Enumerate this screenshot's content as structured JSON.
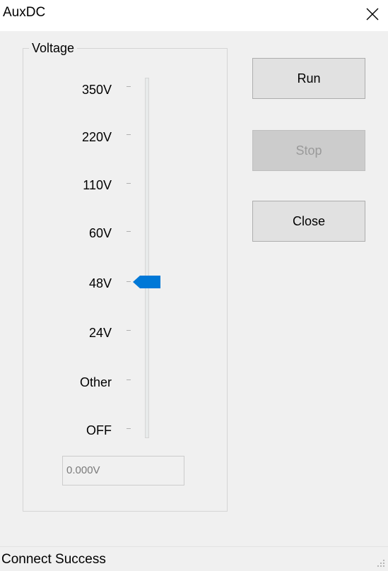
{
  "window": {
    "title": "AuxDC"
  },
  "voltage": {
    "legend": "Voltage",
    "levels": [
      "350V",
      "220V",
      "110V",
      "60V",
      "48V",
      "24V",
      "Other",
      "OFF"
    ],
    "selected": "48V",
    "readout": "0.000V"
  },
  "buttons": {
    "run": "Run",
    "stop": "Stop",
    "close": "Close"
  },
  "status": {
    "text": "Connect Success"
  },
  "colors": {
    "thumb": "#0078d7",
    "disabled_button": "#cccccc",
    "button": "#e1e1e1"
  },
  "icons": {
    "close": "close-x-icon",
    "thumb": "slider-thumb-pointer",
    "grip": "size-grip-dots"
  }
}
